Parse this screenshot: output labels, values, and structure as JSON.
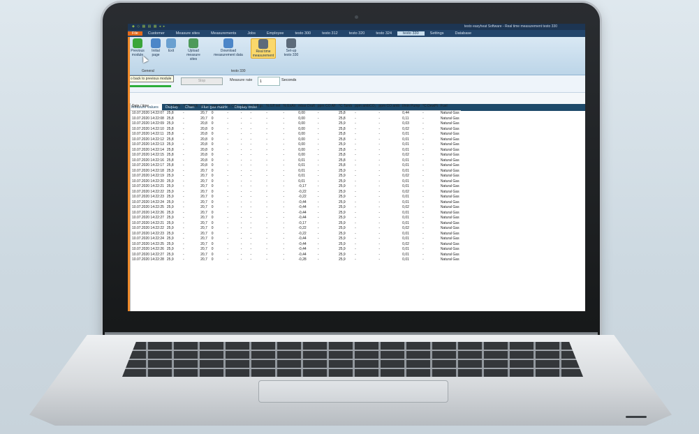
{
  "window": {
    "title": "testo easyheat Software - Real time measurement testo 330",
    "quick_access": "◆ ◇ ▦ ▤ ▦ ◂ ▸"
  },
  "menu": {
    "file": "File",
    "items": [
      "Customer",
      "Measure sites",
      "Measurements",
      "Jobs",
      "Employee",
      "testo 300",
      "testo 312",
      "testo 320",
      "testo 324",
      "testo 330",
      "Settings",
      "Database"
    ],
    "active": "testo 330"
  },
  "ribbon": {
    "buttons": [
      {
        "label": "Previous module",
        "icon": "back-arrow-icon"
      },
      {
        "label": "Initial page",
        "icon": "home-icon"
      },
      {
        "label": "Exit",
        "icon": "exit-icon"
      },
      {
        "label": "Upload measure sites",
        "icon": "upload-icon"
      },
      {
        "label": "Download measurement data",
        "icon": "download-icon"
      },
      {
        "label": "Real time measurement",
        "icon": "device-icon"
      },
      {
        "label": "Set-up testo 330",
        "icon": "setup-icon"
      }
    ],
    "group_general": "General",
    "group_testo": "testo 330"
  },
  "toolbar": {
    "tooltip": "o back to previous module",
    "stop": "Stop",
    "rate_label": "Measure rate",
    "rate_value": "1",
    "rate_unit": "Seconds"
  },
  "tabs": [
    "Measure values",
    "Display",
    "Chart",
    "Flue gas matrix",
    "Display order"
  ],
  "table": {
    "headers": [
      "Date / time",
      "°C Tamb",
      "°C Tstack",
      "% O₂",
      "ppm CO",
      "% CO₂",
      "ratio",
      "% Eff gr.",
      "% Eff net",
      "% ExAir",
      "mbar Draft",
      "ppm CO AF",
      "°C Tamb",
      "ppm ambCO₂",
      "ppm CO amb",
      "l/min Pump",
      "°C DewPt",
      "Fuel"
    ],
    "rows": [
      [
        "10.07.2020 14:22:07",
        "25,8",
        "-",
        "20,7",
        "0",
        "-",
        "-",
        "-",
        "-",
        "-",
        "0,00",
        "-",
        "25,8",
        "-",
        "-",
        "0,44",
        "-",
        "Natural Gas"
      ],
      [
        "10.07.2020 14:22:08",
        "25,8",
        "-",
        "20,7",
        "0",
        "-",
        "-",
        "-",
        "-",
        "-",
        "0,00",
        "-",
        "25,8",
        "-",
        "-",
        "0,11",
        "-",
        "Natural Gas"
      ],
      [
        "10.07.2020 14:22:09",
        "25,9",
        "-",
        "20,8",
        "0",
        "-",
        "-",
        "-",
        "-",
        "-",
        "0,00",
        "-",
        "25,9",
        "-",
        "-",
        "0,03",
        "-",
        "Natural Gas"
      ],
      [
        "10.07.2020 14:22:10",
        "25,8",
        "-",
        "20,8",
        "0",
        "-",
        "-",
        "-",
        "-",
        "-",
        "0,00",
        "-",
        "25,8",
        "-",
        "-",
        "0,02",
        "-",
        "Natural Gas"
      ],
      [
        "10.07.2020 14:22:11",
        "25,8",
        "-",
        "20,8",
        "0",
        "-",
        "-",
        "-",
        "-",
        "-",
        "0,00",
        "-",
        "25,8",
        "-",
        "-",
        "0,01",
        "-",
        "Natural Gas"
      ],
      [
        "10.07.2020 14:22:12",
        "25,8",
        "-",
        "20,8",
        "0",
        "-",
        "-",
        "-",
        "-",
        "-",
        "0,00",
        "-",
        "25,8",
        "-",
        "-",
        "0,01",
        "-",
        "Natural Gas"
      ],
      [
        "10.07.2020 14:22:13",
        "25,9",
        "-",
        "20,8",
        "0",
        "-",
        "-",
        "-",
        "-",
        "-",
        "0,00",
        "-",
        "25,9",
        "-",
        "-",
        "0,01",
        "-",
        "Natural Gas"
      ],
      [
        "10.07.2020 14:22:14",
        "25,8",
        "-",
        "20,8",
        "0",
        "-",
        "-",
        "-",
        "-",
        "-",
        "0,00",
        "-",
        "25,8",
        "-",
        "-",
        "0,01",
        "-",
        "Natural Gas"
      ],
      [
        "10.07.2020 14:22:15",
        "25,8",
        "-",
        "20,8",
        "0",
        "-",
        "-",
        "-",
        "-",
        "-",
        "0,00",
        "-",
        "25,8",
        "-",
        "-",
        "0,02",
        "-",
        "Natural Gas"
      ],
      [
        "10.07.2020 14:22:16",
        "25,8",
        "-",
        "20,8",
        "0",
        "-",
        "-",
        "-",
        "-",
        "-",
        "0,01",
        "-",
        "25,8",
        "-",
        "-",
        "0,01",
        "-",
        "Natural Gas"
      ],
      [
        "10.07.2020 14:22:17",
        "25,8",
        "-",
        "20,8",
        "0",
        "-",
        "-",
        "-",
        "-",
        "-",
        "0,01",
        "-",
        "25,8",
        "-",
        "-",
        "0,01",
        "-",
        "Natural Gas"
      ],
      [
        "10.07.2020 14:22:18",
        "25,9",
        "-",
        "20,7",
        "0",
        "-",
        "-",
        "-",
        "-",
        "-",
        "0,01",
        "-",
        "25,9",
        "-",
        "-",
        "0,01",
        "-",
        "Natural Gas"
      ],
      [
        "10.07.2020 14:22:19",
        "25,9",
        "-",
        "20,7",
        "0",
        "-",
        "-",
        "-",
        "-",
        "-",
        "0,01",
        "-",
        "25,9",
        "-",
        "-",
        "0,02",
        "-",
        "Natural Gas"
      ],
      [
        "10.07.2020 14:22:20",
        "25,9",
        "-",
        "20,7",
        "0",
        "-",
        "-",
        "-",
        "-",
        "-",
        "0,01",
        "-",
        "25,9",
        "-",
        "-",
        "0,01",
        "-",
        "Natural Gas"
      ],
      [
        "10.07.2020 14:22:21",
        "25,9",
        "-",
        "20,7",
        "0",
        "-",
        "-",
        "-",
        "-",
        "-",
        "-0,17",
        "-",
        "25,9",
        "-",
        "-",
        "0,01",
        "-",
        "Natural Gas"
      ],
      [
        "10.07.2020 14:22:22",
        "25,9",
        "-",
        "20,7",
        "0",
        "-",
        "-",
        "-",
        "-",
        "-",
        "-0,22",
        "-",
        "25,9",
        "-",
        "-",
        "0,02",
        "-",
        "Natural Gas"
      ],
      [
        "10.07.2020 14:22:23",
        "25,9",
        "-",
        "20,7",
        "0",
        "-",
        "-",
        "-",
        "-",
        "-",
        "-0,22",
        "-",
        "25,9",
        "-",
        "-",
        "0,01",
        "-",
        "Natural Gas"
      ],
      [
        "10.07.2020 14:22:24",
        "25,9",
        "-",
        "20,7",
        "0",
        "-",
        "-",
        "-",
        "-",
        "-",
        "-0,44",
        "-",
        "25,9",
        "-",
        "-",
        "0,01",
        "-",
        "Natural Gas"
      ],
      [
        "10.07.2020 14:22:25",
        "25,9",
        "-",
        "20,7",
        "0",
        "-",
        "-",
        "-",
        "-",
        "-",
        "-0,44",
        "-",
        "25,9",
        "-",
        "-",
        "0,02",
        "-",
        "Natural Gas"
      ],
      [
        "10.07.2020 14:22:26",
        "25,9",
        "-",
        "20,7",
        "0",
        "-",
        "-",
        "-",
        "-",
        "-",
        "-0,44",
        "-",
        "25,9",
        "-",
        "-",
        "0,01",
        "-",
        "Natural Gas"
      ],
      [
        "10.07.2020 14:22:27",
        "25,9",
        "-",
        "20,7",
        "0",
        "-",
        "-",
        "-",
        "-",
        "-",
        "-0,44",
        "-",
        "25,9",
        "-",
        "-",
        "0,01",
        "-",
        "Natural Gas"
      ],
      [
        "10.07.2020 14:22:21",
        "25,9",
        "-",
        "20,7",
        "0",
        "-",
        "-",
        "-",
        "-",
        "-",
        "-0,17",
        "-",
        "25,9",
        "-",
        "-",
        "0,01",
        "-",
        "Natural Gas"
      ],
      [
        "10.07.2020 14:22:22",
        "25,9",
        "-",
        "20,7",
        "0",
        "-",
        "-",
        "-",
        "-",
        "-",
        "-0,22",
        "-",
        "25,9",
        "-",
        "-",
        "0,02",
        "-",
        "Natural Gas"
      ],
      [
        "10.07.2020 14:22:23",
        "25,9",
        "-",
        "20,7",
        "0",
        "-",
        "-",
        "-",
        "-",
        "-",
        "-0,22",
        "-",
        "25,9",
        "-",
        "-",
        "0,01",
        "-",
        "Natural Gas"
      ],
      [
        "10.07.2020 14:22:24",
        "25,9",
        "-",
        "20,7",
        "0",
        "-",
        "-",
        "-",
        "-",
        "-",
        "-0,44",
        "-",
        "25,9",
        "-",
        "-",
        "0,01",
        "-",
        "Natural Gas"
      ],
      [
        "10.07.2020 14:22:25",
        "25,9",
        "-",
        "20,7",
        "0",
        "-",
        "-",
        "-",
        "-",
        "-",
        "-0,44",
        "-",
        "25,9",
        "-",
        "-",
        "0,02",
        "-",
        "Natural Gas"
      ],
      [
        "10.07.2020 14:22:26",
        "25,9",
        "-",
        "20,7",
        "0",
        "-",
        "-",
        "-",
        "-",
        "-",
        "-0,44",
        "-",
        "25,9",
        "-",
        "-",
        "0,01",
        "-",
        "Natural Gas"
      ],
      [
        "10.07.2020 14:22:27",
        "25,9",
        "-",
        "20,7",
        "0",
        "-",
        "-",
        "-",
        "-",
        "-",
        "-0,44",
        "-",
        "25,9",
        "-",
        "-",
        "0,01",
        "-",
        "Natural Gas"
      ],
      [
        "10.07.2020 14:22:28",
        "25,9",
        "-",
        "20,7",
        "0",
        "-",
        "-",
        "-",
        "-",
        "-",
        "-0,28",
        "-",
        "25,9",
        "-",
        "-",
        "0,01",
        "-",
        "Natural Gas"
      ]
    ]
  },
  "colors": {
    "title": "#1d3552",
    "menu": "#23456b",
    "file": "#e66b1c",
    "tabs": "#1e4a6a",
    "accent": "#f08a2a"
  }
}
